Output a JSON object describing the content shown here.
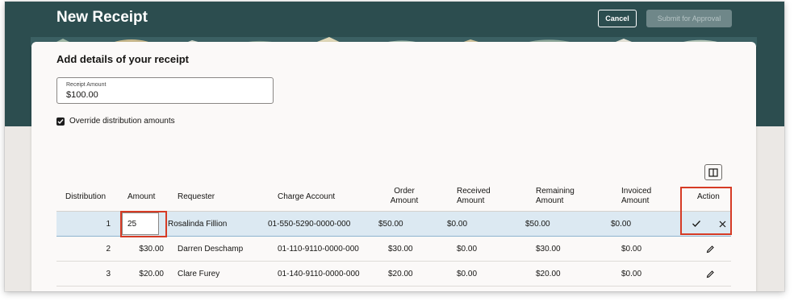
{
  "header": {
    "title": "New Receipt",
    "cancel_label": "Cancel",
    "submit_label": "Submit for Approval"
  },
  "form": {
    "section_title": "Add details of your receipt",
    "receipt_amount_label": "Receipt Amount",
    "receipt_amount_value": "$100.00",
    "override_label": "Override distribution amounts",
    "override_checked": true
  },
  "table": {
    "headers": {
      "distribution": "Distribution",
      "amount": "Amount",
      "requester": "Requester",
      "charge_account": "Charge Account",
      "order_amount_1": "Order",
      "order_amount_2": "Amount",
      "received_amount_1": "Received",
      "received_amount_2": "Amount",
      "remaining_amount_1": "Remaining",
      "remaining_amount_2": "Amount",
      "invoiced_amount_1": "Invoiced",
      "invoiced_amount_2": "Amount",
      "action": "Action"
    },
    "rows": [
      {
        "distribution": "1",
        "amount": "25",
        "requester": "Rosalinda Fillion",
        "charge_account": "01-550-5290-0000-000",
        "order_amount": "$50.00",
        "received_amount": "$0.00",
        "remaining_amount": "$50.00",
        "invoiced_amount": "$0.00"
      },
      {
        "distribution": "2",
        "amount": "$30.00",
        "requester": "Darren Deschamp",
        "charge_account": "01-110-9110-0000-000",
        "order_amount": "$30.00",
        "received_amount": "$0.00",
        "remaining_amount": "$30.00",
        "invoiced_amount": "$0.00"
      },
      {
        "distribution": "3",
        "amount": "$20.00",
        "requester": "Clare Furey",
        "charge_account": "01-140-9110-0000-000",
        "order_amount": "$20.00",
        "received_amount": "$0.00",
        "remaining_amount": "$20.00",
        "invoiced_amount": "$0.00"
      }
    ]
  },
  "colors": {
    "header_band": "#2c4d4f",
    "selected_row": "#dce9f2",
    "highlight": "#d63b25"
  },
  "icons": {
    "checkbox": "checkmark-icon",
    "columns": "columns-icon",
    "save_row": "check-icon",
    "cancel_row": "close-icon",
    "edit_row": "pencil-icon"
  }
}
